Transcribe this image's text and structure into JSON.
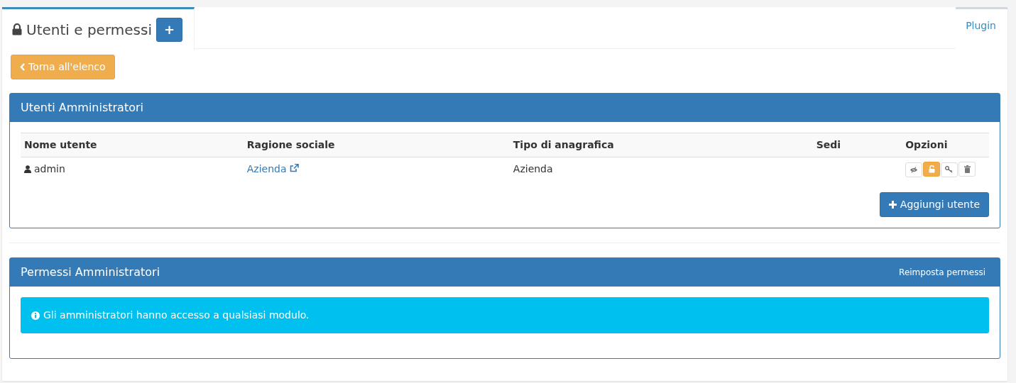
{
  "tabs": [
    {
      "label": "Utenti e permessi",
      "selected": true,
      "add_button": "+"
    },
    {
      "label": "Plugin",
      "selected": false
    }
  ],
  "back_button": "Torna all'elenco",
  "users_panel": {
    "title": "Utenti Amministratori",
    "table": {
      "columns": [
        "Nome utente",
        "Ragione sociale",
        "Tipo di anagrafica",
        "Sedi",
        "Opzioni"
      ],
      "rows": [
        {
          "user": "admin",
          "company": "Azienda",
          "type": "Azienda",
          "sites": "",
          "options": [
            {
              "kind": "view",
              "highlighted": false
            },
            {
              "kind": "unlock",
              "highlighted": true
            },
            {
              "kind": "key",
              "highlighted": false
            },
            {
              "kind": "delete",
              "highlighted": false
            }
          ]
        }
      ]
    },
    "add_button": "Aggiungi utente"
  },
  "permissions_panel": {
    "title": "Permessi Amministratori",
    "action": "Reimposta permessi",
    "alert": "Gli amministratori hanno accesso a qualsiasi modulo."
  }
}
